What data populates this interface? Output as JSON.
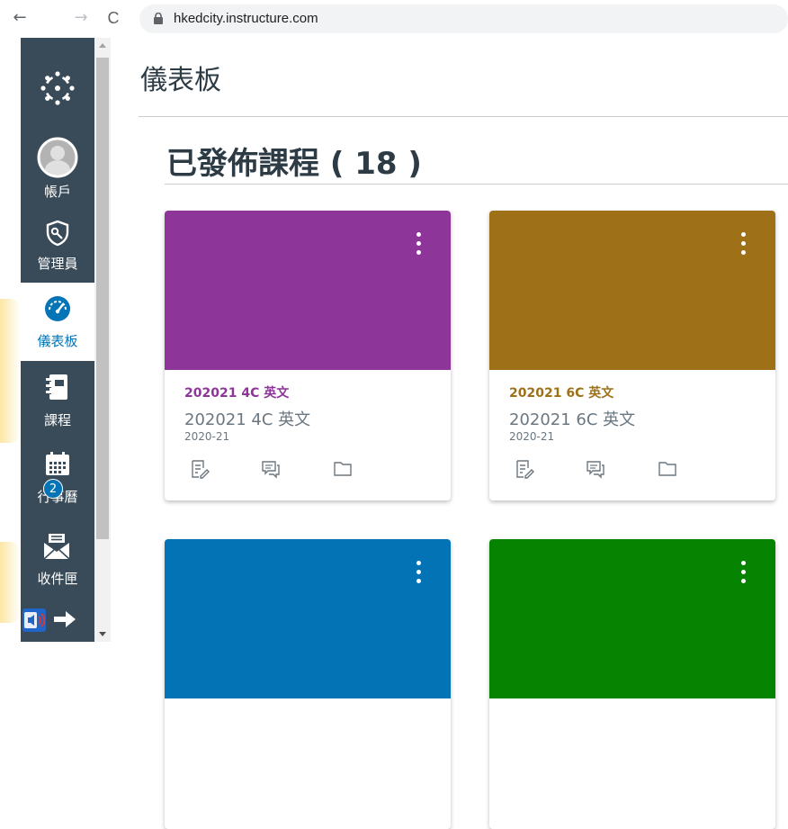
{
  "browser": {
    "back_glyph": "←",
    "forward_glyph": "→",
    "reload_glyph": "C",
    "url": "hkedcity.instructure.com"
  },
  "sidebar": {
    "items": [
      {
        "label": "",
        "icon": "canvas-logo-icon"
      },
      {
        "label": "帳戶",
        "icon": "avatar-icon"
      },
      {
        "label": "管理員",
        "icon": "admin-shield-icon"
      },
      {
        "label": "儀表板",
        "icon": "dashboard-gauge-icon",
        "active": true
      },
      {
        "label": "課程",
        "icon": "courses-book-icon"
      },
      {
        "label": "行事曆",
        "icon": "calendar-icon"
      },
      {
        "label": "收件匣",
        "icon": "inbox-icon",
        "badge": "2"
      },
      {
        "label": "",
        "icon": "history-arrow-icon"
      }
    ]
  },
  "main": {
    "page_title": "儀表板",
    "section_title": "已發佈課程 ( 18 )"
  },
  "courses": [
    {
      "short": "202021 4C 英文",
      "name": "202021 4C 英文",
      "term": "2020-21",
      "color": "#8e3599"
    },
    {
      "short": "202021 6C 英文",
      "name": "202021 6C 英文",
      "term": "2020-21",
      "color": "#9e7119"
    },
    {
      "short": "",
      "name": "",
      "term": "",
      "color": "#0373b6"
    },
    {
      "short": "",
      "name": "",
      "term": "",
      "color": "#068300"
    }
  ],
  "colors": {
    "sidebar_bg": "#394b58",
    "accent": "#0374b5",
    "text_dark": "#2d3b45",
    "text_muted": "#6b7780"
  }
}
